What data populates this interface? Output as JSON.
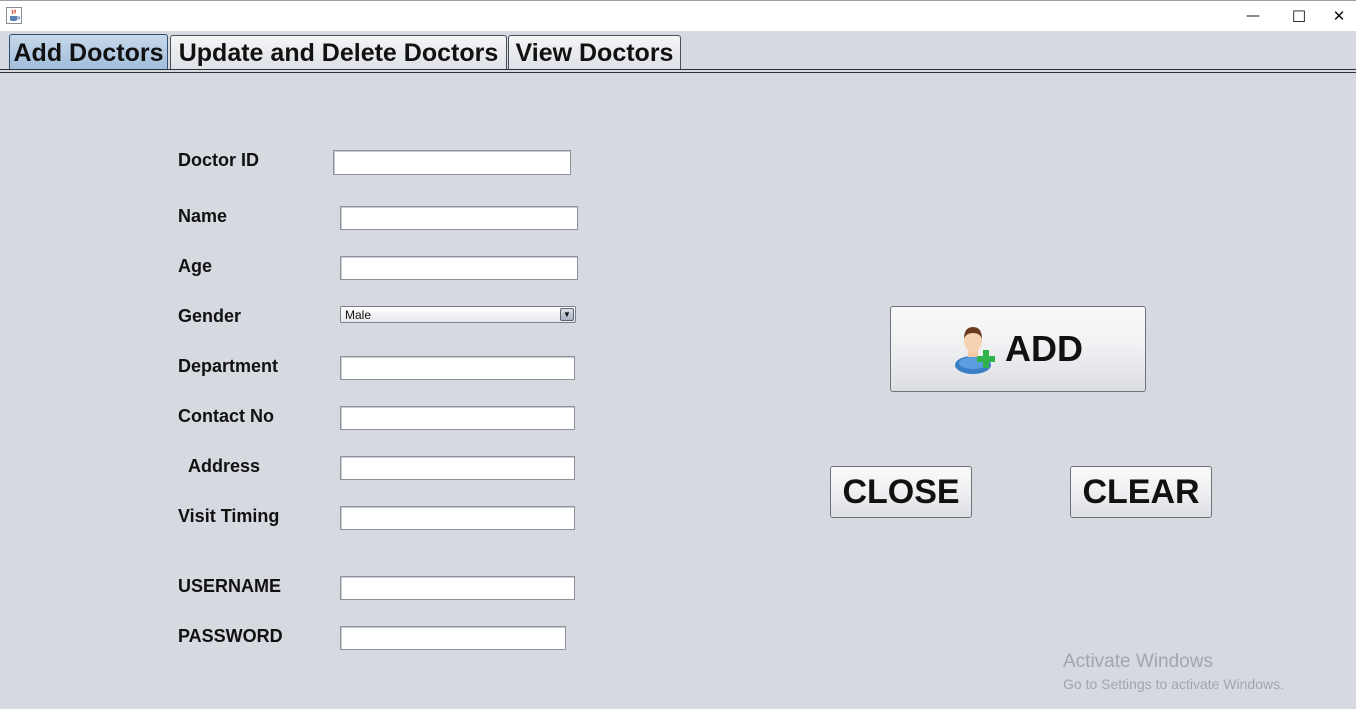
{
  "window": {
    "minimize_glyph": "—",
    "maximize_glyph": "☐",
    "close_glyph": "✕"
  },
  "tabs": [
    {
      "label": "Add Doctors",
      "active": true
    },
    {
      "label": "Update and Delete Doctors",
      "active": false
    },
    {
      "label": "View Doctors",
      "active": false
    }
  ],
  "form": {
    "doctor_id": {
      "label": "Doctor ID",
      "value": ""
    },
    "name": {
      "label": "Name",
      "value": ""
    },
    "age": {
      "label": "Age",
      "value": ""
    },
    "gender": {
      "label": "Gender",
      "selected": "Male"
    },
    "department": {
      "label": "Department",
      "value": ""
    },
    "contact_no": {
      "label": "Contact No",
      "value": ""
    },
    "address": {
      "label": "Address",
      "value": ""
    },
    "visit_timing": {
      "label": "Visit Timing",
      "value": ""
    },
    "username": {
      "label": "USERNAME",
      "value": ""
    },
    "password": {
      "label": "PASSWORD",
      "value": ""
    }
  },
  "buttons": {
    "add": "ADD",
    "close": "CLOSE",
    "clear": "CLEAR"
  },
  "icons": {
    "app": "java-cup-icon",
    "add": "add-user-icon"
  },
  "watermark": {
    "title": "Activate Windows",
    "subtitle": "Go to Settings to activate Windows."
  },
  "colors": {
    "background": "#d6d9df",
    "active_tab": "#aac4de",
    "icon_green": "#2fb34a"
  }
}
